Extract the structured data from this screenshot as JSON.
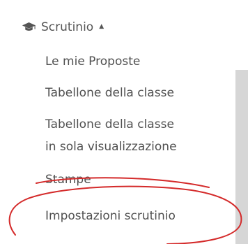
{
  "menu": {
    "section": {
      "icon": "graduation-cap-icon",
      "label": "Scrutinio",
      "caret": "▲"
    },
    "items": [
      {
        "label": "Le mie Proposte"
      },
      {
        "label": "Tabellone della classe"
      },
      {
        "label_line1": "Tabellone della classe",
        "label_line2": "in sola visualizzazione"
      },
      {
        "label": "Stampe"
      },
      {
        "label": "Impostazioni scrutinio"
      }
    ]
  },
  "annotation": {
    "color": "#d42a2a",
    "shape": "hand-drawn-ellipse"
  }
}
